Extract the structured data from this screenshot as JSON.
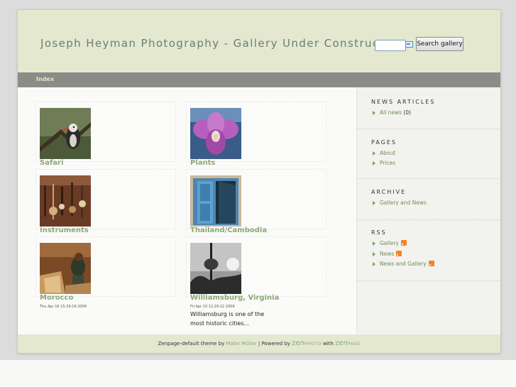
{
  "header": {
    "site_title": "Joseph Heyman Photography - Gallery Under Construction",
    "search_placeholder": "",
    "search_button": "Search gallery"
  },
  "nav": {
    "index_label": "Index"
  },
  "albums": [
    {
      "title": "Safari",
      "date": "",
      "description": ""
    },
    {
      "title": "Plants",
      "date": "",
      "description": ""
    },
    {
      "title": "Instruments",
      "date": "",
      "description": ""
    },
    {
      "title": "Thailand/Cambodia",
      "date": "",
      "description": ""
    },
    {
      "title": "Morocco",
      "date": "Thu Apr 16 15:29:16 2009",
      "description": ""
    },
    {
      "title": "Williamsburg, Virginia",
      "date": "Fri Apr 10 12:20:22 2009",
      "description": "Williamsburg is one of the most historic cities..."
    }
  ],
  "sidebar": {
    "news": {
      "heading": "NEWS ARTICLES",
      "items": [
        {
          "label": "All news",
          "count": "(0)"
        }
      ]
    },
    "pages": {
      "heading": "PAGES",
      "items": [
        {
          "label": "About"
        },
        {
          "label": "Prices"
        }
      ]
    },
    "archive": {
      "heading": "ARCHIVE",
      "items": [
        {
          "label": "Gallery and News"
        }
      ]
    },
    "rss": {
      "heading": "RSS",
      "items": [
        {
          "label": "Gallery"
        },
        {
          "label": "News"
        },
        {
          "label": "News and Gallery"
        }
      ]
    }
  },
  "footer": {
    "theme_text": "Zenpage-default theme by",
    "author_link": "Malte Müller",
    "powered_text": "| Powered by",
    "zen1": "zen",
    "photo": "PHOTO",
    "with_text": "with",
    "zen2": "zen",
    "page": "PAGE"
  },
  "colors": {
    "header_bg": "#e3e8cf",
    "navbar_bg": "#8a8d87",
    "accent_green": "#8ba877",
    "sidebar_bg": "#f2f3ee"
  },
  "icons": {
    "search": "search-icon",
    "bullet": "arrow-bullet-icon",
    "rss": "rss-feed-icon"
  }
}
